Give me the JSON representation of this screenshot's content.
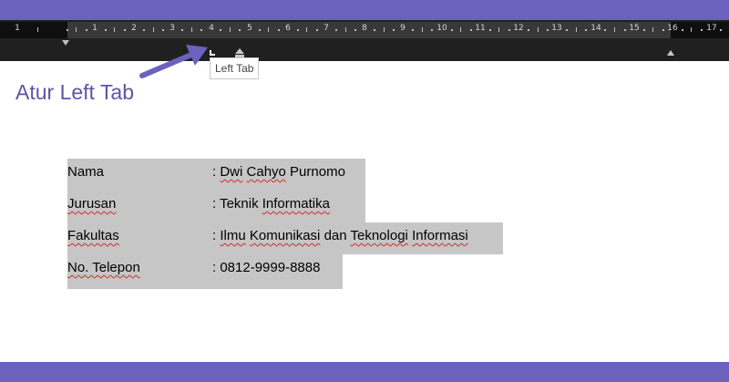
{
  "ruler": {
    "numbers": [
      "1",
      "1",
      "2",
      "3",
      "4",
      "5",
      "6",
      "7",
      "8",
      "9",
      "10",
      "11",
      "12",
      "13",
      "14",
      "15",
      "16",
      "17"
    ]
  },
  "tooltip": {
    "text": "Left Tab"
  },
  "annotation": {
    "text": "Atur Left Tab"
  },
  "document": {
    "rows": [
      {
        "label": "Nama",
        "value": [
          {
            "t": ": "
          },
          {
            "t": "Dwi",
            "s": true
          },
          {
            "t": " "
          },
          {
            "t": "Cahyo",
            "s": true
          },
          {
            "t": " Purnomo"
          }
        ]
      },
      {
        "label": "Jurusan",
        "label_spell": true,
        "value": [
          {
            "t": ": Teknik "
          },
          {
            "t": "Informatika",
            "s": true
          }
        ]
      },
      {
        "label": "Fakultas",
        "label_spell": true,
        "value": [
          {
            "t": ": "
          },
          {
            "t": "Ilmu",
            "s": true
          },
          {
            "t": " "
          },
          {
            "t": "Komunikasi",
            "s": true
          },
          {
            "t": " dan "
          },
          {
            "t": "Teknologi",
            "s": true
          },
          {
            "t": " "
          },
          {
            "t": "Informasi",
            "s": true
          }
        ]
      },
      {
        "label": "No. Telepon",
        "label_spell": true,
        "value": [
          {
            "t": ":  0812-9999-8888"
          }
        ]
      }
    ]
  },
  "colors": {
    "frame_band": "#6a62bd",
    "annotation": "#5c55a8",
    "selection": "#c6c6c6",
    "ruler_bg": "#202020",
    "spellcheck": "#d42a2a"
  }
}
